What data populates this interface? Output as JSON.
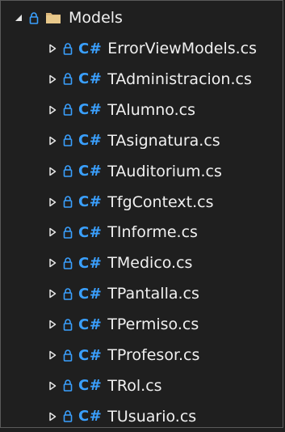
{
  "explorer": {
    "folder": {
      "name": "Models",
      "icon": "folder-icon",
      "expanded": true
    },
    "files": [
      {
        "name": "ErrorViewModels.cs",
        "lang_badge": "C#"
      },
      {
        "name": "TAdministracion.cs",
        "lang_badge": "C#"
      },
      {
        "name": "TAlumno.cs",
        "lang_badge": "C#"
      },
      {
        "name": "TAsignatura.cs",
        "lang_badge": "C#"
      },
      {
        "name": "TAuditorium.cs",
        "lang_badge": "C#"
      },
      {
        "name": "TfgContext.cs",
        "lang_badge": "C#"
      },
      {
        "name": "TInforme.cs",
        "lang_badge": "C#"
      },
      {
        "name": "TMedico.cs",
        "lang_badge": "C#"
      },
      {
        "name": "TPantalla.cs",
        "lang_badge": "C#"
      },
      {
        "name": "TPermiso.cs",
        "lang_badge": "C#"
      },
      {
        "name": "TProfesor.cs",
        "lang_badge": "C#"
      },
      {
        "name": "TRol.cs",
        "lang_badge": "C#"
      },
      {
        "name": "TUsuario.cs",
        "lang_badge": "C#"
      }
    ]
  },
  "colors": {
    "background": "#1f1f1f",
    "text": "#f0f0f0",
    "csharp_badge": "#3aa0ff",
    "lock": "#3aa0ff",
    "folder": "#dcb67a"
  }
}
